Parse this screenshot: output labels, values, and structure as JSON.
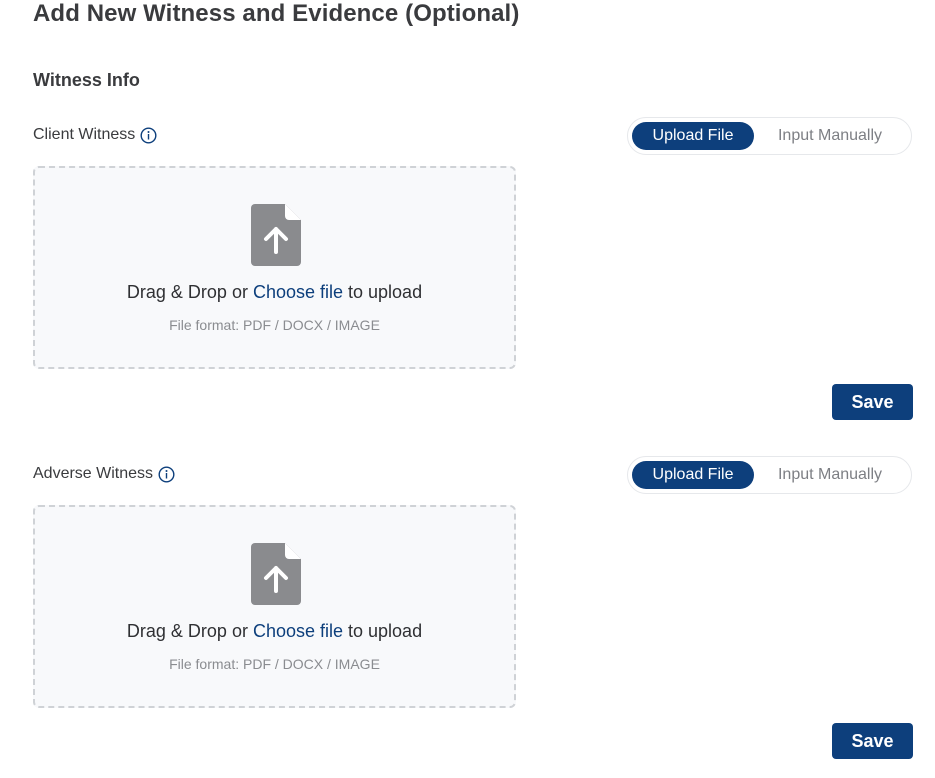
{
  "page": {
    "title": "Add New Witness and Evidence (Optional)",
    "section_title": "Witness Info"
  },
  "colors": {
    "primary": "#0d3f7c",
    "muted_text": "#8a8c90",
    "dashed_border": "#cfd2d6",
    "file_icon": "#8a8b8e"
  },
  "witnesses": [
    {
      "label": "Client Witness",
      "info_icon": "info-icon",
      "toggle": {
        "upload_label": "Upload File",
        "manual_label": "Input Manually",
        "selected": "upload"
      },
      "dropzone": {
        "icon": "file-upload-icon",
        "text_before": "Drag & Drop or ",
        "link_text": "Choose file",
        "text_after": " to upload",
        "format_text": "File format: PDF / DOCX / IMAGE"
      },
      "save_label": "Save"
    },
    {
      "label": "Adverse Witness",
      "info_icon": "info-icon",
      "toggle": {
        "upload_label": "Upload File",
        "manual_label": "Input Manually",
        "selected": "upload"
      },
      "dropzone": {
        "icon": "file-upload-icon",
        "text_before": "Drag & Drop or ",
        "link_text": "Choose file",
        "text_after": " to upload",
        "format_text": "File format: PDF / DOCX / IMAGE"
      },
      "save_label": "Save"
    }
  ]
}
